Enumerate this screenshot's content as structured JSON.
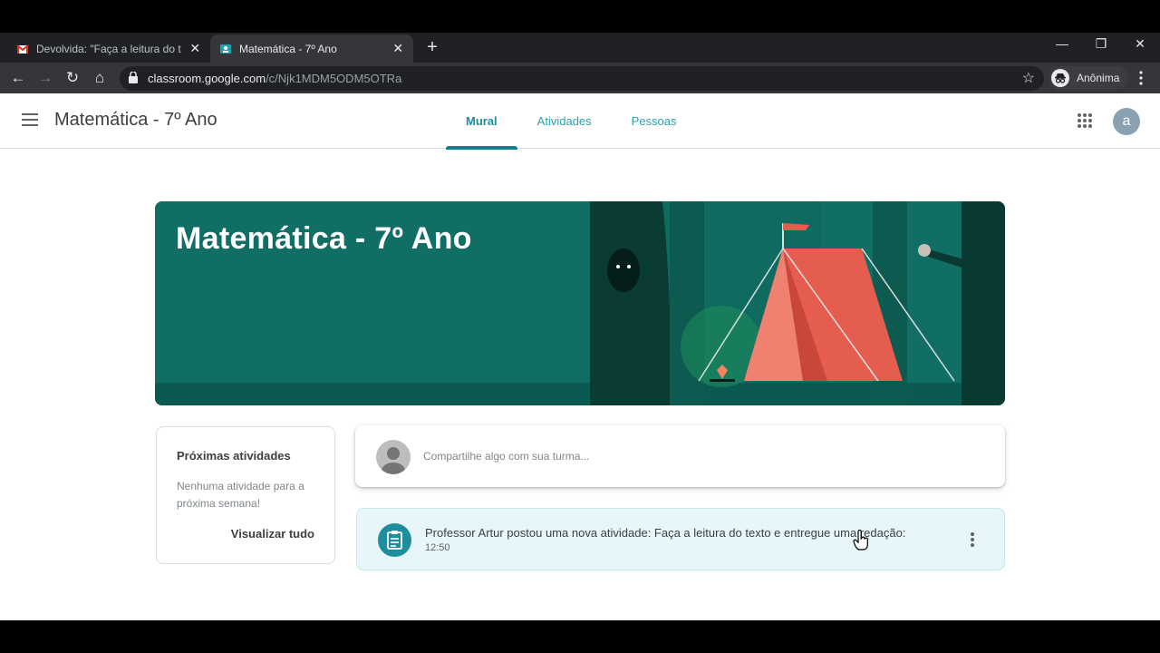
{
  "browser": {
    "tabs": [
      {
        "title": "Devolvida: \"Faça a leitura do texto",
        "icon": "gmail-icon"
      },
      {
        "title": "Matemática - 7º Ano",
        "icon": "classroom-icon",
        "active": true
      }
    ],
    "url_host": "classroom.google.com",
    "url_path": "/c/Njk1MDM5ODM5OTRa",
    "profile_label": "Anônima"
  },
  "app": {
    "class_title": "Matemática - 7º Ano",
    "tabs": [
      "Mural",
      "Atividades",
      "Pessoas"
    ],
    "avatar_letter": "a",
    "banner_title": "Matemática - 7º Ano",
    "upcoming": {
      "heading": "Próximas atividades",
      "empty_text": "Nenhuma atividade para a próxima semana!",
      "view_all": "Visualizar tudo"
    },
    "share_placeholder": "Compartilhe algo com sua turma...",
    "post": {
      "text": "Professor Artur postou uma nova atividade: Faça a leitura do texto e entregue uma redação:",
      "time": "12:50"
    }
  },
  "colors": {
    "accent": "#1e8e9e",
    "banner": "#106e65"
  }
}
